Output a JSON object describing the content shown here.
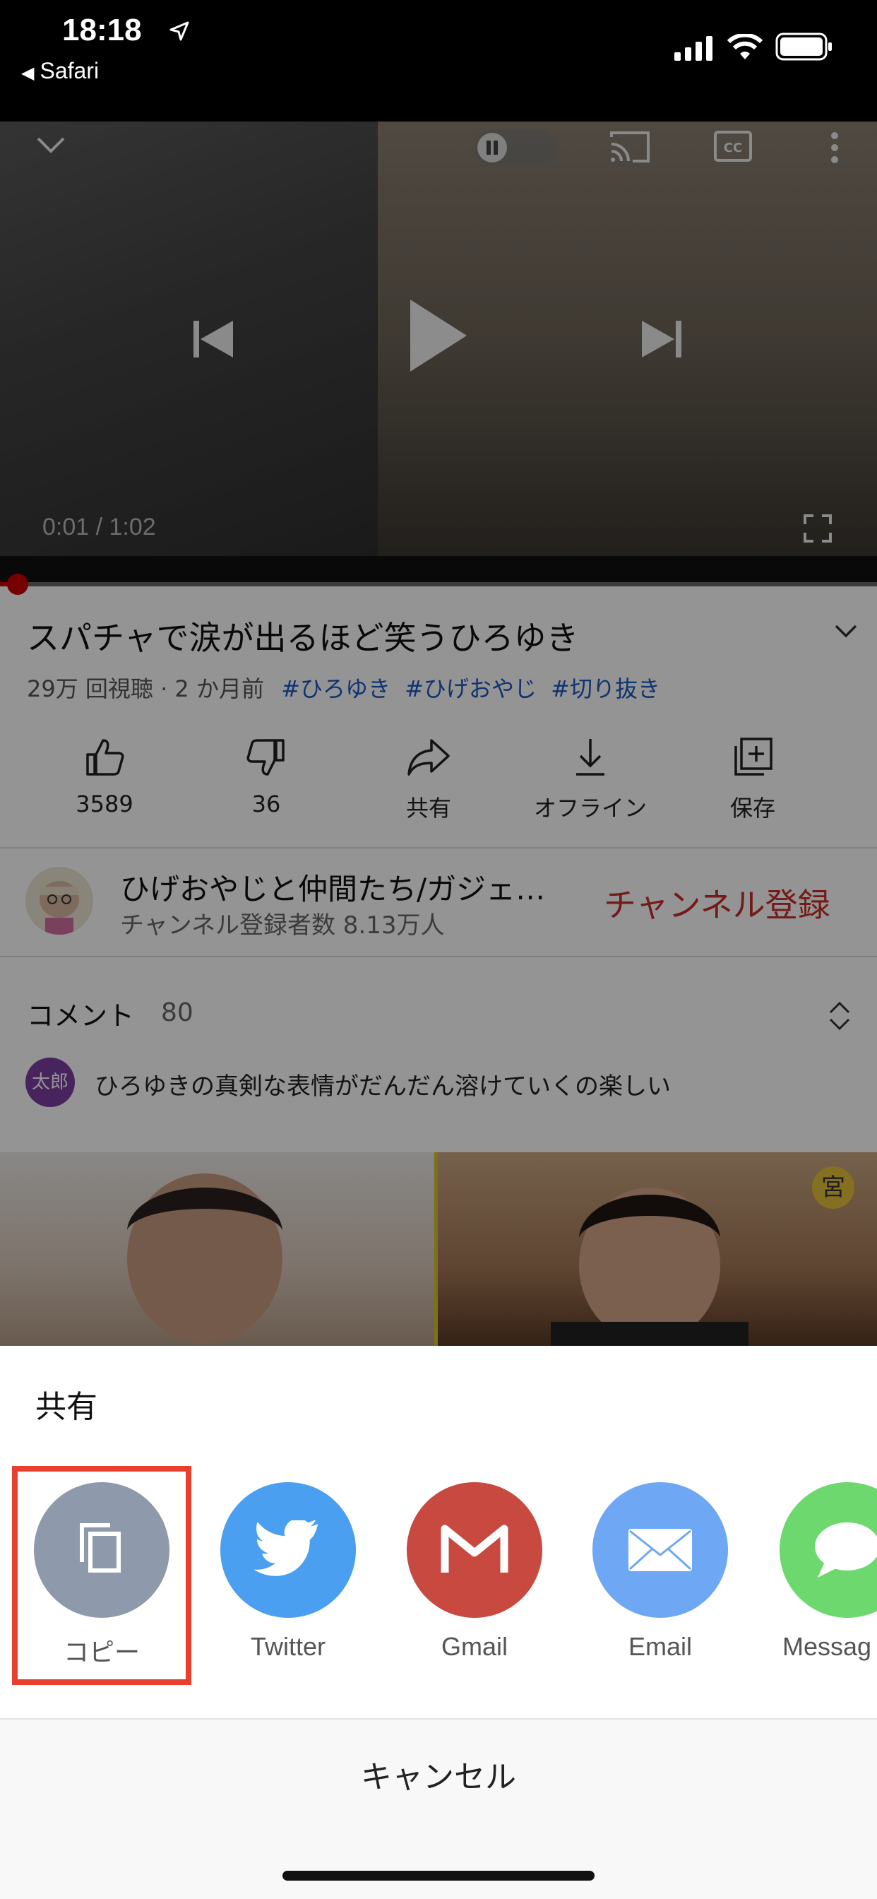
{
  "status_bar": {
    "time": "18:18",
    "back_app": "Safari"
  },
  "player": {
    "time_display": "0:01 / 1:02",
    "progress": 0.02
  },
  "video": {
    "title": "スパチャで涙が出るほど笑うひろゆき",
    "meta": "29万 回視聴 · 2 か月前",
    "tags": [
      "#ひろゆき",
      "#ひげおやじ",
      "#切り抜き"
    ]
  },
  "actions": [
    {
      "label": "3589",
      "icon": "thumbs-up-icon"
    },
    {
      "label": "36",
      "icon": "thumbs-down-icon"
    },
    {
      "label": "共有",
      "icon": "share-arrow-icon"
    },
    {
      "label": "オフライン",
      "icon": "download-icon"
    },
    {
      "label": "保存",
      "icon": "save-playlist-icon"
    }
  ],
  "channel": {
    "name": "ひげおやじと仲間たち/ガジェ…",
    "subscribers": "チャンネル登録者数 8.13万人",
    "subscribe_label": "チャンネル登録"
  },
  "comments": {
    "label": "コメント",
    "count": "80",
    "first_avatar_text": "太郎",
    "first_comment": "ひろゆきの真剣な表情がだんだん溶けていくの楽しい"
  },
  "thumbnail_badge": "宮",
  "share_sheet": {
    "title": "共有",
    "items": [
      {
        "label": "コピー",
        "color": "#8e99ac",
        "icon": "copy-icon"
      },
      {
        "label": "Twitter",
        "color": "#4a9ff0",
        "icon": "twitter-bird-icon"
      },
      {
        "label": "Gmail",
        "color": "#c8493f",
        "icon": "gmail-icon"
      },
      {
        "label": "Email",
        "color": "#6ea8f5",
        "icon": "envelope-icon"
      },
      {
        "label": "Messag",
        "color": "#6cd86e",
        "icon": "message-bubble-icon"
      }
    ],
    "cancel_label": "キャンセル"
  }
}
